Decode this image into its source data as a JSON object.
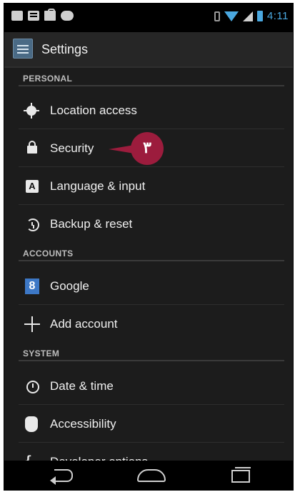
{
  "status_bar": {
    "time": "4:11",
    "left_icons": [
      "email-icon",
      "message-icon",
      "shopping-bag-icon",
      "game-controller-icon"
    ],
    "right_icons": [
      "vibrate-icon",
      "wifi-icon",
      "signal-icon",
      "battery-icon"
    ]
  },
  "action_bar": {
    "title": "Settings",
    "icon": "settings-app-icon"
  },
  "sections": {
    "personal": "PERSONAL",
    "accounts": "ACCOUNTS",
    "system": "SYSTEM"
  },
  "items": {
    "location": {
      "label": "Location access",
      "icon": "location-icon"
    },
    "security": {
      "label": "Security",
      "icon": "lock-icon"
    },
    "language": {
      "label": "Language & input",
      "icon": "keyboard-a-icon",
      "glyph": "A"
    },
    "backup": {
      "label": "Backup & reset",
      "icon": "backup-icon"
    },
    "google": {
      "label": "Google",
      "icon": "google-icon",
      "glyph": "8"
    },
    "add_account": {
      "label": "Add account",
      "icon": "plus-icon"
    },
    "date_time": {
      "label": "Date & time",
      "icon": "clock-icon"
    },
    "accessibility": {
      "label": "Accessibility",
      "icon": "hand-icon"
    },
    "developer": {
      "label": "Developer options",
      "icon": "braces-icon",
      "glyph": "{ }"
    }
  },
  "callout": {
    "label": "٣",
    "color": "#9c1c3d"
  },
  "nav_bar": {
    "buttons": [
      "back-icon",
      "home-icon",
      "recent-apps-icon"
    ]
  },
  "colors": {
    "accent": "#4aa8e0",
    "background": "#1c1c1c",
    "callout": "#9c1c3d"
  }
}
